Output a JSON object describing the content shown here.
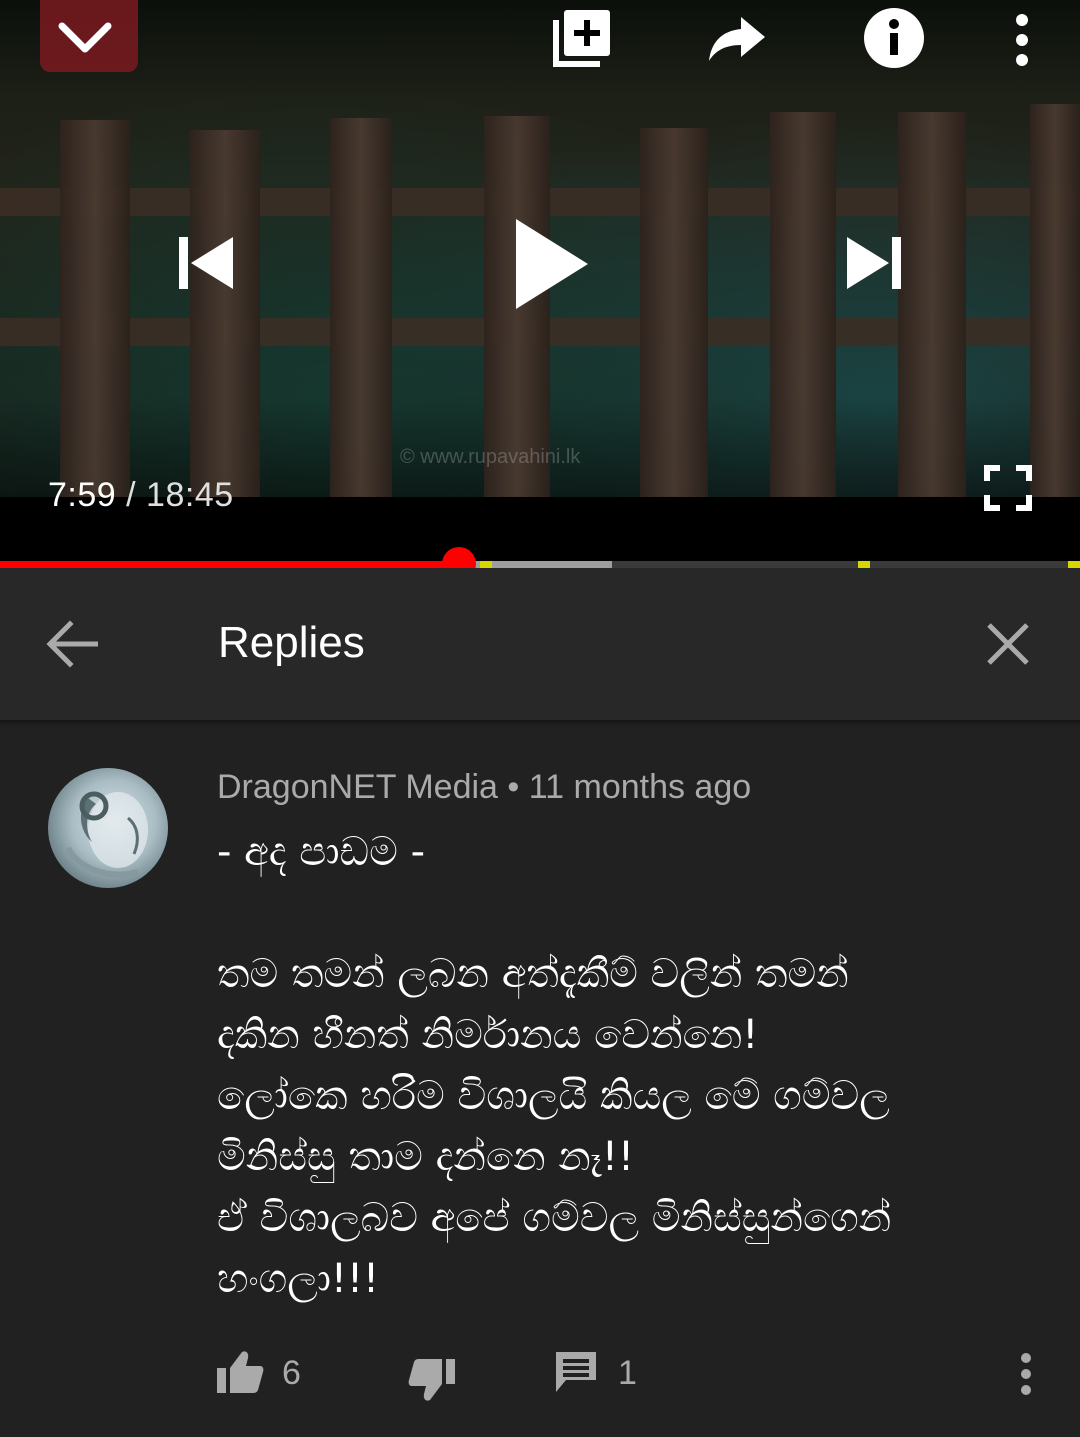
{
  "player": {
    "watermark": "© www.rupavahini.lk",
    "current_time": "7:59",
    "separator": " / ",
    "duration": "18:45",
    "progress_played_fraction": 0.425,
    "progress_buffered_fraction": 0.567,
    "icons": {
      "collapse": "chevron-down-icon",
      "add_to_playlist": "add-to-playlist-icon",
      "share": "share-icon",
      "info": "info-icon",
      "more": "more-vertical-icon",
      "previous": "skip-previous-icon",
      "play": "play-icon",
      "next": "skip-next-icon",
      "fullscreen": "fullscreen-icon"
    },
    "colors": {
      "progress_played": "#ff0000",
      "ad_marker": "#d6d600"
    }
  },
  "replies_panel": {
    "title": "Replies",
    "back_icon": "arrow-back-icon",
    "close_icon": "close-icon"
  },
  "comment": {
    "author": "DragonNET Media",
    "bullet": " • ",
    "age": "11 months ago",
    "lines": [
      "- අද පාඩම -",
      "",
      "තම තමන් ලබන අත්දැකීම් වලින් තමන්",
      "දකින හීනත් නිර්මානය වෙන්නෙ!",
      "ලෝකෙ හරිම විශාලයි කියල මේ ගම්වල",
      "මිනිස්සු තාම දන්නෙ නෑ!!",
      "ඒ විශාලබව අපේ ගම්වල මිනිස්සුන්ගෙන්",
      "හංගලා!!!"
    ],
    "likes": "6",
    "replies": "1",
    "action_icons": {
      "like": "thumb-up-icon",
      "dislike": "thumb-down-icon",
      "reply": "reply-comment-icon",
      "more": "more-vertical-icon"
    }
  }
}
